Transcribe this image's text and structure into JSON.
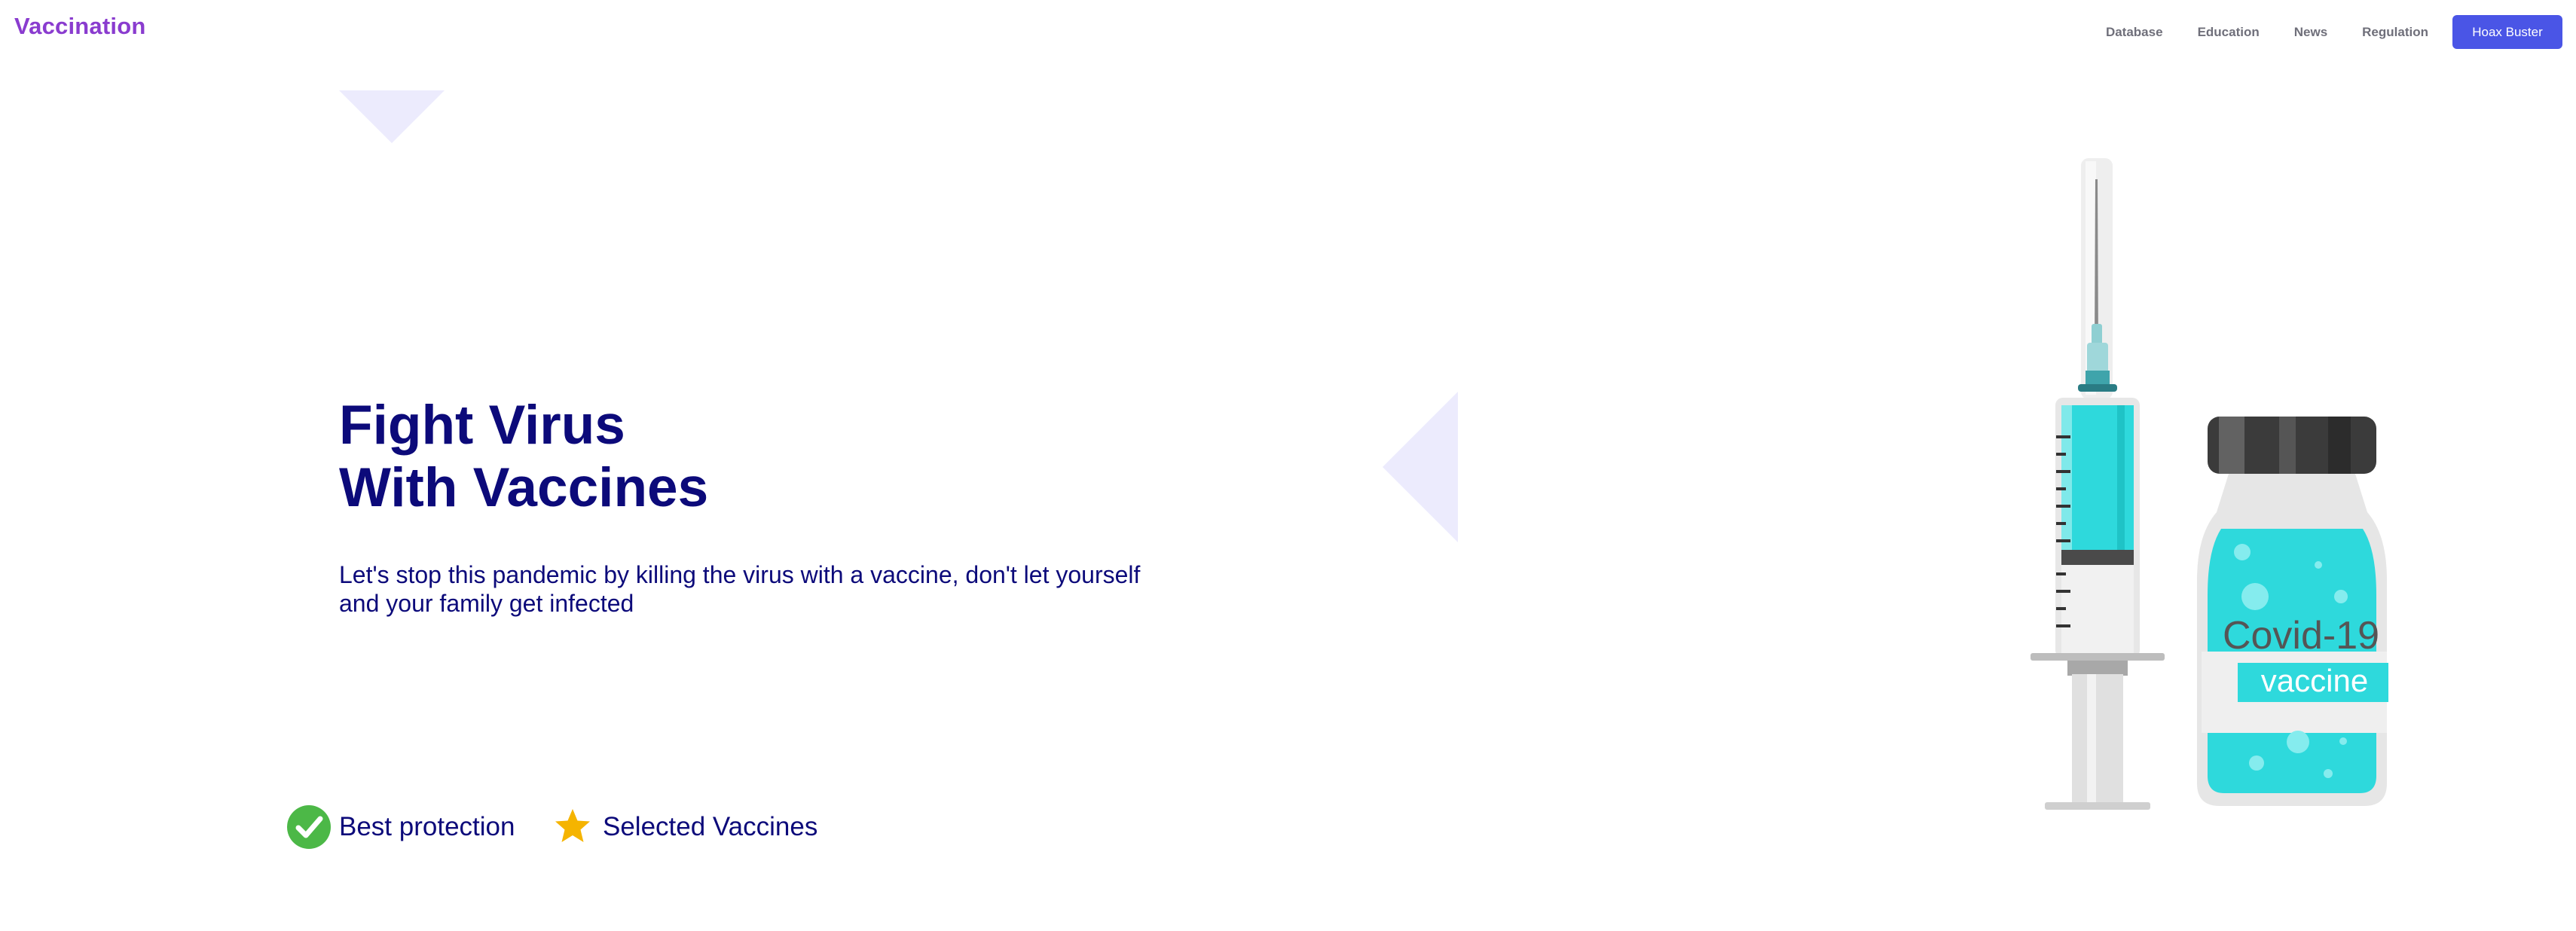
{
  "header": {
    "brand": "Vaccination",
    "nav": [
      "Database",
      "Education",
      "News",
      "Regulation"
    ],
    "cta": "Hoax Buster"
  },
  "hero": {
    "title_line1": "Fight Virus",
    "title_line2": "With Vaccines",
    "subtitle_line1": "Let's stop this pandemic by killing the virus with a vaccine, don't let yourself",
    "subtitle_line2": "and your family get infected"
  },
  "features": [
    {
      "icon": "check-circle-icon",
      "label": "Best protection",
      "color": "#4cb847"
    },
    {
      "icon": "star-icon",
      "label": "Selected Vaccines",
      "color": "#f5b400"
    }
  ],
  "illustration": {
    "vial_line1": "Covid-19",
    "vial_line2": "vaccine"
  },
  "colors": {
    "brand": "#8a3ccf",
    "primary_button": "#4a55e6",
    "heading": "#0c0a7a",
    "decor": "#ecebfd",
    "liquid": "#2ed9dc"
  }
}
